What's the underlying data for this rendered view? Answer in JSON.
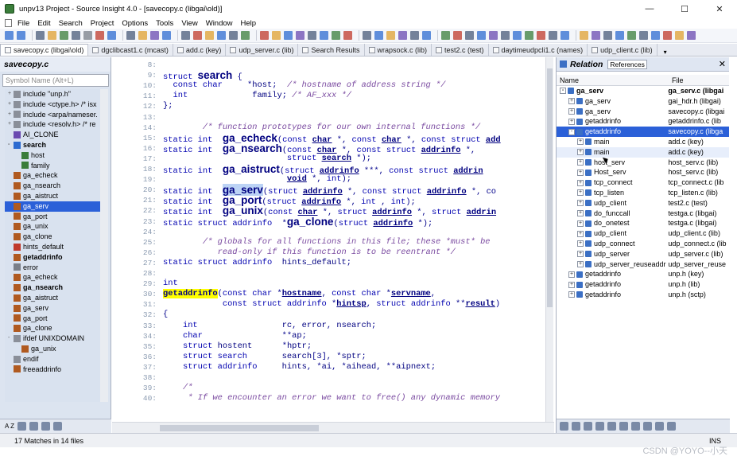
{
  "window": {
    "title": "unpv13 Project - Source Insight 4.0 - [savecopy.c (libgai\\old)]",
    "minimize": "—",
    "maximize": "☐",
    "close": "✕"
  },
  "menu": [
    "File",
    "Edit",
    "Search",
    "Project",
    "Options",
    "Tools",
    "View",
    "Window",
    "Help"
  ],
  "tabs": [
    {
      "label": "savecopy.c (libgai\\old)",
      "active": true
    },
    {
      "label": "dgclibcast1.c (mcast)"
    },
    {
      "label": "add.c (key)"
    },
    {
      "label": "udp_server.c (lib)"
    },
    {
      "label": "Search Results"
    },
    {
      "label": "wrapsock.c (lib)"
    },
    {
      "label": "test2.c (test)"
    },
    {
      "label": "daytimeudpcli1.c (names)"
    },
    {
      "label": "udp_client.c (lib)"
    }
  ],
  "tab_overflow": "▾",
  "symbol_panel": {
    "title": "savecopy.c",
    "search_placeholder": "Symbol Name (Alt+L)",
    "items": [
      {
        "label": "include \"unp.h\"",
        "indent": 0,
        "icon": "include",
        "exp": "+"
      },
      {
        "label": "include <ctype.h> /* isx",
        "indent": 0,
        "icon": "include",
        "exp": "+"
      },
      {
        "label": "include <arpa/nameser.",
        "indent": 0,
        "icon": "include",
        "exp": "+"
      },
      {
        "label": "include <resolv.h> /* re",
        "indent": 0,
        "icon": "include",
        "exp": "+"
      },
      {
        "label": "AI_CLONE",
        "indent": 0,
        "icon": "macro"
      },
      {
        "label": "search",
        "indent": 0,
        "icon": "struct",
        "bold": true,
        "exp": "-"
      },
      {
        "label": "host",
        "indent": 1,
        "icon": "field"
      },
      {
        "label": "family",
        "indent": 1,
        "icon": "field"
      },
      {
        "label": "ga_echeck",
        "indent": 0,
        "icon": "func"
      },
      {
        "label": "ga_nsearch",
        "indent": 0,
        "icon": "func"
      },
      {
        "label": "ga_aistruct",
        "indent": 0,
        "icon": "func"
      },
      {
        "label": "ga_serv",
        "indent": 0,
        "icon": "func",
        "selected": true
      },
      {
        "label": "ga_port",
        "indent": 0,
        "icon": "func"
      },
      {
        "label": "ga_unix",
        "indent": 0,
        "icon": "func"
      },
      {
        "label": "ga_clone",
        "indent": 0,
        "icon": "func"
      },
      {
        "label": "hints_default",
        "indent": 0,
        "icon": "var"
      },
      {
        "label": "getaddrinfo",
        "indent": 0,
        "icon": "func",
        "bold": true
      },
      {
        "label": "error",
        "indent": 0,
        "icon": "label"
      },
      {
        "label": "ga_echeck",
        "indent": 0,
        "icon": "func"
      },
      {
        "label": "ga_nsearch",
        "indent": 0,
        "icon": "func",
        "bold": true
      },
      {
        "label": "ga_aistruct",
        "indent": 0,
        "icon": "func"
      },
      {
        "label": "ga_serv",
        "indent": 0,
        "icon": "func"
      },
      {
        "label": "ga_port",
        "indent": 0,
        "icon": "func"
      },
      {
        "label": "ga_clone",
        "indent": 0,
        "icon": "func"
      },
      {
        "label": "ifdef UNIXDOMAIN",
        "indent": 0,
        "icon": "ifdef",
        "exp": "-"
      },
      {
        "label": "ga_unix",
        "indent": 1,
        "icon": "func"
      },
      {
        "label": "endif",
        "indent": 0,
        "icon": "ifdef"
      },
      {
        "label": "freeaddrinfo",
        "indent": 0,
        "icon": "func"
      }
    ],
    "sort_label": "A Z"
  },
  "code_lines": [
    {
      "n": "8",
      "html": ""
    },
    {
      "n": "9",
      "html": "<span class='kw'>struct</span> <span class='big'>search</span> {"
    },
    {
      "n": "10",
      "html": "  <span class='kw'>const char</span>     *<span class='id'>host</span>;  <span class='cm'>/* hostname of address string */</span>"
    },
    {
      "n": "11",
      "html": "  <span class='kw'>int</span>             <span class='id'>family</span>; <span class='cm'>/* AF_xxx */</span>"
    },
    {
      "n": "12",
      "html": "};"
    },
    {
      "n": "13",
      "html": ""
    },
    {
      "n": "14",
      "html": "        <span class='cm'>/* function prototypes for our own internal functions */</span>"
    },
    {
      "n": "15",
      "html": "<span class='kw'>static int</span>  <span class='big'>ga_echeck</span>(<span class='kw'>const</span> <span class='ul'>char</span> *, <span class='kw'>const</span> <span class='ul'>char</span> *, <span class='kw'>const struct</span> <span class='ul'>add</span>"
    },
    {
      "n": "16",
      "html": "<span class='kw'>static int</span>  <span class='big'>ga_nsearch</span>(<span class='kw'>const</span> <span class='ul'>char</span> *, <span class='kw'>const struct</span> <span class='ul'>addrinfo</span> *,"
    },
    {
      "n": "17",
      "html": "                         <span class='kw'>struct</span> <span class='ul'>search</span> *);"
    },
    {
      "n": "18",
      "html": "<span class='kw'>static int</span>  <span class='big'>ga_aistruct</span>(<span class='kw'>struct</span> <span class='ul'>addrinfo</span> ***, <span class='kw'>const struct</span> <span class='ul'>addrin</span>"
    },
    {
      "n": "19",
      "html": "                         <span class='ul'>void</span> *, <span class='kw'>int</span>);"
    },
    {
      "n": "20",
      "html": "<span class='kw'>static int</span>  <span class='big hl-b'>ga_serv</span>(<span class='kw'>struct</span> <span class='ul'>addrinfo</span> *, <span class='kw'>const struct</span> <span class='ul'>addrinfo</span> *, co"
    },
    {
      "n": "21",
      "html": "<span class='kw'>static int</span>  <span class='big'>ga_port</span>(<span class='kw'>struct</span> <span class='ul'>addrinfo</span> *, <span class='kw'>int</span> , <span class='kw'>int</span>);"
    },
    {
      "n": "22",
      "html": "<span class='kw'>static int</span>  <span class='big'>ga_unix</span>(<span class='kw'>const</span> <span class='ul'>char</span> *, <span class='kw'>struct</span> <span class='ul'>addrinfo</span> *, <span class='kw'>struct</span> <span class='ul'>addrin</span>"
    },
    {
      "n": "23",
      "html": "<span class='kw'>static struct</span> <span class='kw'>addrinfo</span>  *<span class='big'>ga_clone</span>(<span class='kw'>struct</span> <span class='ul'>addrinfo</span> *);"
    },
    {
      "n": "24",
      "html": ""
    },
    {
      "n": "25",
      "html": "        <span class='cm'>/* globals for all functions in this file; these *must* be</span>"
    },
    {
      "n": "26",
      "html": "           <span class='cm'>read-only if this function is to be reentrant */</span>"
    },
    {
      "n": "27",
      "html": "<span class='kw'>static struct</span> <span class='kw'>addrinfo</span>  <span class='id'>hints_default</span>;"
    },
    {
      "n": "28",
      "html": ""
    },
    {
      "n": "29",
      "html": "<span class='kw'>int</span>"
    },
    {
      "n": "30",
      "html": "<span class='fn hl-y'>getaddrinfo</span>(<span class='kw'>const char</span> *<span class='ul'>hostname</span>, <span class='kw'>const char</span> *<span class='ul'>servname</span>,"
    },
    {
      "n": "31",
      "html": "            <span class='kw'>const struct</span> <span class='kw'>addrinfo</span> *<span class='ul'>hintsp</span>, <span class='kw'>struct</span> <span class='kw'>addrinfo</span> **<span class='ul'>result</span>)"
    },
    {
      "n": "32",
      "html": "{"
    },
    {
      "n": "33",
      "html": "    <span class='kw'>int</span>                 <span class='id'>rc</span>, <span class='id'>error</span>, <span class='id'>nsearch</span>;"
    },
    {
      "n": "34",
      "html": "    <span class='kw'>char</span>                **<span class='id'>ap</span>;"
    },
    {
      "n": "35",
      "html": "    <span class='kw'>struct</span> <span class='id'>hostent</span>      *<span class='id'>hptr</span>;"
    },
    {
      "n": "36",
      "html": "    <span class='kw'>struct search</span>       <span class='id'>search</span>[3], *<span class='id'>sptr</span>;"
    },
    {
      "n": "37",
      "html": "    <span class='kw'>struct addrinfo</span>     <span class='id'>hints</span>, *<span class='id'>ai</span>, *<span class='id'>aihead</span>, **<span class='id'>aipnext</span>;"
    },
    {
      "n": "38",
      "html": ""
    },
    {
      "n": "39",
      "html": "    <span class='cm'>/*</span>"
    },
    {
      "n": "40",
      "html": "     <span class='cm'>* If we encounter an error we want to free() any dynamic memory</span>"
    }
  ],
  "relation_panel": {
    "title": "Relation",
    "tab": "References",
    "close": "✕",
    "col_name": "Name",
    "col_file": "File",
    "rows": [
      {
        "name": "ga_serv",
        "file": "ga_serv.c (libgai",
        "indent": 0,
        "exp": "-",
        "bold": true
      },
      {
        "name": "ga_serv",
        "file": "gai_hdr.h (libgai)",
        "indent": 1,
        "exp": "+"
      },
      {
        "name": "ga_serv",
        "file": "savecopy.c (libgai",
        "indent": 1,
        "exp": "+"
      },
      {
        "name": "getaddrinfo",
        "file": "getaddrinfo.c (lib",
        "indent": 1,
        "exp": "+"
      },
      {
        "name": "getaddrinfo",
        "file": "savecopy.c (libga",
        "indent": 1,
        "exp": "-",
        "selected": true
      },
      {
        "name": "main",
        "file": "add.c (key)",
        "indent": 2,
        "exp": "+"
      },
      {
        "name": "main",
        "file": "add.c (key)",
        "indent": 2,
        "exp": "+",
        "alt": true
      },
      {
        "name": "host_serv",
        "file": "host_serv.c (lib)",
        "indent": 2,
        "exp": "+"
      },
      {
        "name": "Host_serv",
        "file": "host_serv.c (lib)",
        "indent": 2,
        "exp": "+"
      },
      {
        "name": "tcp_connect",
        "file": "tcp_connect.c (lib",
        "indent": 2,
        "exp": "+"
      },
      {
        "name": "tcp_listen",
        "file": "tcp_listen.c (lib)",
        "indent": 2,
        "exp": "+"
      },
      {
        "name": "udp_client",
        "file": "test2.c (test)",
        "indent": 2,
        "exp": "+"
      },
      {
        "name": "do_funccall",
        "file": "testga.c (libgai)",
        "indent": 2,
        "exp": "+"
      },
      {
        "name": "do_onetest",
        "file": "testga.c (libgai)",
        "indent": 2,
        "exp": "+"
      },
      {
        "name": "udp_client",
        "file": "udp_client.c (lib)",
        "indent": 2,
        "exp": "+"
      },
      {
        "name": "udp_connect",
        "file": "udp_connect.c (lib",
        "indent": 2,
        "exp": "+"
      },
      {
        "name": "udp_server",
        "file": "udp_server.c (lib)",
        "indent": 2,
        "exp": "+"
      },
      {
        "name": "udp_server_reuseaddr",
        "file": "udp_server_reuse",
        "indent": 2,
        "exp": "+"
      },
      {
        "name": "getaddrinfo",
        "file": "unp.h (key)",
        "indent": 1,
        "exp": "+"
      },
      {
        "name": "getaddrinfo",
        "file": "unp.h (lib)",
        "indent": 1,
        "exp": "+"
      },
      {
        "name": "getaddrinfo",
        "file": "unp.h (sctp)",
        "indent": 1,
        "exp": "+"
      }
    ]
  },
  "status": {
    "matches": "17 Matches in 14 files",
    "mode": "INS"
  },
  "watermark": "CSDN @YOYO--小天",
  "colors": {
    "selection": "#2b60d8",
    "keyword": "#0000b0",
    "comment": "#7a4aa0",
    "highlight": "#ffff00"
  }
}
